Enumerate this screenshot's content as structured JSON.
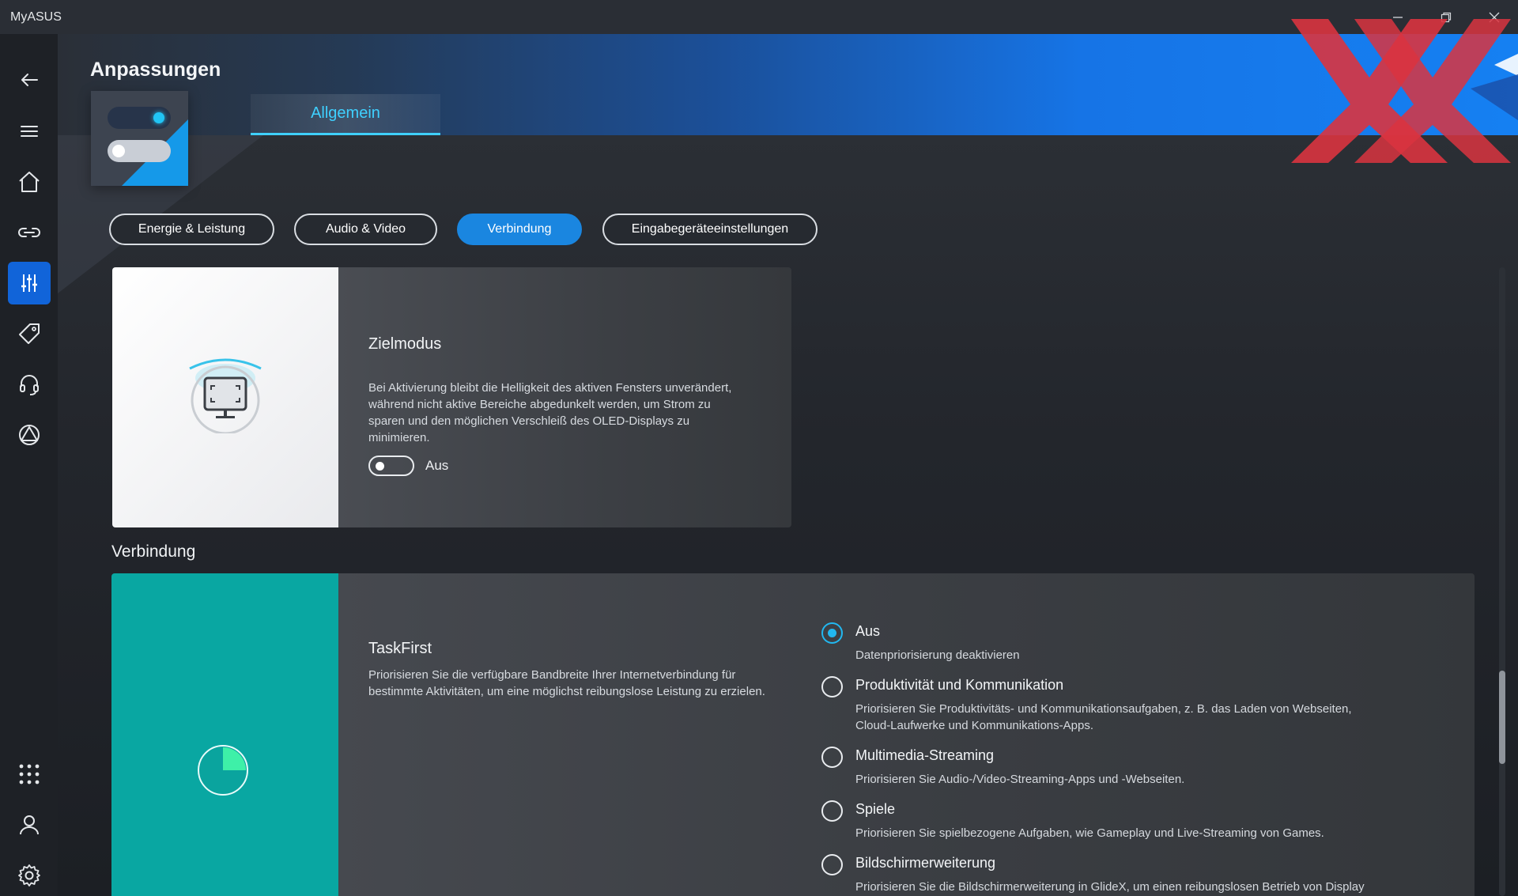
{
  "window": {
    "title": "MyASUS",
    "controls": [
      "minimize-icon",
      "restore-icon",
      "close-icon"
    ]
  },
  "sidebar": {
    "items": [
      {
        "icon": "back-arrow-icon"
      },
      {
        "icon": "hamburger-menu-icon"
      },
      {
        "icon": "home-icon"
      },
      {
        "icon": "link-icon"
      },
      {
        "icon": "customization-sliders-icon",
        "active": true
      },
      {
        "icon": "tag-icon"
      },
      {
        "icon": "headset-icon"
      },
      {
        "icon": "triangle-circle-icon"
      },
      {
        "icon": "apps-grid-icon"
      },
      {
        "icon": "user-icon"
      },
      {
        "icon": "settings-gear-icon"
      }
    ]
  },
  "header": {
    "title": "Anpassungen",
    "tab": "Allgemein"
  },
  "categories": [
    {
      "label": "Energie & Leistung",
      "active": false
    },
    {
      "label": "Audio & Video",
      "active": false
    },
    {
      "label": "Verbindung",
      "active": true
    },
    {
      "label": "Eingabegeräteeinstellungen",
      "active": false
    }
  ],
  "zielmodus": {
    "title": "Zielmodus",
    "description": "Bei Aktivierung bleibt die Helligkeit des aktiven Fensters unverändert, während nicht aktive Bereiche abgedunkelt werden, um Strom zu sparen und den möglichen Verschleiß des OLED-Displays zu minimieren.",
    "desc_lines": [
      "Bei Aktivierung bleibt die Helligkeit des aktiven Fensters unverändert,",
      "während nicht aktive Bereiche abgedunkelt werden, um Strom zu",
      "sparen und den möglichen Verschleiß des OLED-Displays zu",
      "minimieren."
    ],
    "toggle_state": "Aus",
    "toggle_on": false
  },
  "section": {
    "title": "Verbindung"
  },
  "taskfirst": {
    "title": "TaskFirst",
    "desc_lines": [
      "Priorisieren Sie die verfügbare Bandbreite Ihrer Internetverbindung für",
      "bestimmte Aktivitäten, um eine möglichst reibungslose Leistung zu erzielen."
    ],
    "options": [
      {
        "label": "Aus",
        "desc_lines": [
          "Datenpriorisierung deaktivieren"
        ],
        "checked": true
      },
      {
        "label": "Produktivität und Kommunikation",
        "desc_lines": [
          "Priorisieren Sie Produktivitäts- und Kommunikationsaufgaben, z. B. das Laden von Webseiten,",
          "Cloud-Laufwerke und Kommunikations-Apps."
        ],
        "checked": false
      },
      {
        "label": "Multimedia-Streaming",
        "desc_lines": [
          "Priorisieren Sie Audio-/Video-Streaming-Apps und -Webseiten."
        ],
        "checked": false
      },
      {
        "label": "Spiele",
        "desc_lines": [
          "Priorisieren Sie spielbezogene Aufgaben, wie Gameplay und Live-Streaming von Games."
        ],
        "checked": false
      },
      {
        "label": "Bildschirmerweiterung",
        "desc_lines": [
          "Priorisieren Sie die Bildschirmerweiterung in GlideX, um einen reibungslosen Betrieb von Display"
        ],
        "checked": false
      }
    ]
  },
  "colors": {
    "accent": "#1a86e0",
    "radio_accent": "#22b8f0",
    "teal": "#09a7a2",
    "tab_text": "#3fd0ff",
    "logo_red": "#d9343f"
  }
}
